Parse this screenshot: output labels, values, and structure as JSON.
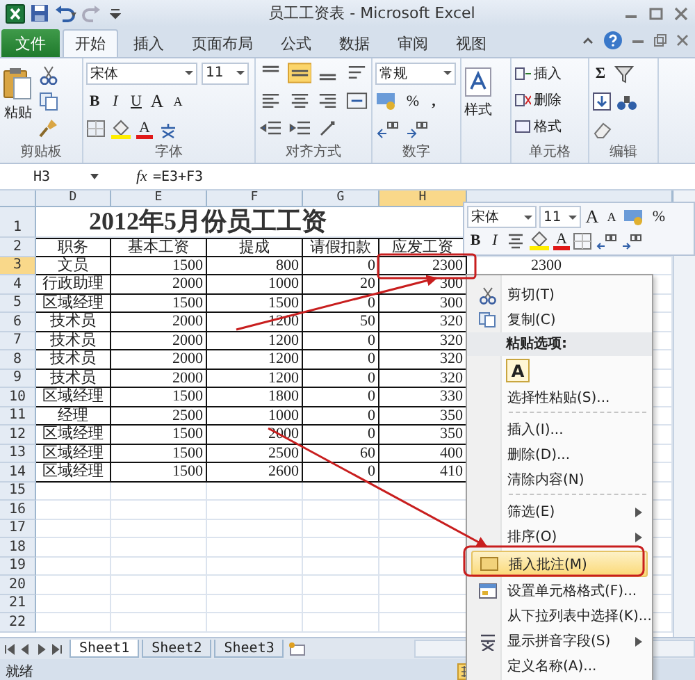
{
  "window": {
    "title": "员工工资表 - Microsoft Excel"
  },
  "tabs": [
    {
      "label": "文件",
      "kind": "file",
      "selected": false
    },
    {
      "label": "开始",
      "kind": "tab",
      "selected": true
    },
    {
      "label": "插入",
      "kind": "tab",
      "selected": false
    },
    {
      "label": "页面布局",
      "kind": "tab",
      "selected": false
    },
    {
      "label": "公式",
      "kind": "tab",
      "selected": false
    },
    {
      "label": "数据",
      "kind": "tab",
      "selected": false
    },
    {
      "label": "审阅",
      "kind": "tab",
      "selected": false
    },
    {
      "label": "视图",
      "kind": "tab",
      "selected": false
    }
  ],
  "ribbon": {
    "clipboard": {
      "paste": "粘贴",
      "label": "剪贴板"
    },
    "font": {
      "name": "宋体",
      "size": "11",
      "bold": "B",
      "italic": "I",
      "underline": "U",
      "grow": "A",
      "shrink": "A",
      "font_color_button": "A",
      "label": "字体"
    },
    "alignment": {
      "label": "对齐方式"
    },
    "number": {
      "format": "常规",
      "percent": "%",
      "comma": ",",
      "label": "数字"
    },
    "styles": {
      "button": "样式"
    },
    "cells": {
      "insert": "插入",
      "delete": "删除",
      "format": "格式",
      "label": "单元格"
    },
    "editing": {
      "sum": "Σ",
      "label": "编辑"
    }
  },
  "formula_bar": {
    "name_box": "H3",
    "function": "fx",
    "formula": "=E3+F3"
  },
  "sheet": {
    "columns": [
      {
        "label": "D",
        "selected": false
      },
      {
        "label": "E",
        "selected": false
      },
      {
        "label": "F",
        "selected": false
      },
      {
        "label": "G",
        "selected": false
      },
      {
        "label": "H",
        "selected": true
      }
    ],
    "row_numbers": [
      {
        "label": "1",
        "selected": false
      },
      {
        "label": "2",
        "selected": false
      },
      {
        "label": "3",
        "selected": true
      },
      {
        "label": "4",
        "selected": false
      },
      {
        "label": "5",
        "selected": false
      },
      {
        "label": "6",
        "selected": false
      },
      {
        "label": "7",
        "selected": false
      },
      {
        "label": "8",
        "selected": false
      },
      {
        "label": "9",
        "selected": false
      },
      {
        "label": "10",
        "selected": false
      },
      {
        "label": "11",
        "selected": false
      },
      {
        "label": "12",
        "selected": false
      },
      {
        "label": "13",
        "selected": false
      },
      {
        "label": "14",
        "selected": false
      },
      {
        "label": "15",
        "selected": false
      },
      {
        "label": "16",
        "selected": false
      },
      {
        "label": "17",
        "selected": false
      },
      {
        "label": "18",
        "selected": false
      },
      {
        "label": "19",
        "selected": false
      },
      {
        "label": "20",
        "selected": false
      },
      {
        "label": "21",
        "selected": false
      },
      {
        "label": "22",
        "selected": false
      }
    ],
    "title": "2012年5月份员工工资",
    "header": [
      "职务",
      "基本工资",
      "提成",
      "请假扣款",
      "应发工资"
    ],
    "rows": [
      [
        "文员",
        "1500",
        "800",
        "0",
        "2300"
      ],
      [
        "行政助理",
        "2000",
        "1000",
        "20",
        "300"
      ],
      [
        "区域经理",
        "1500",
        "1500",
        "0",
        "300"
      ],
      [
        "技术员",
        "2000",
        "1200",
        "50",
        "320"
      ],
      [
        "技术员",
        "2000",
        "1200",
        "0",
        "320"
      ],
      [
        "技术员",
        "2000",
        "1200",
        "0",
        "320"
      ],
      [
        "技术员",
        "2000",
        "1200",
        "0",
        "320"
      ],
      [
        "区域经理",
        "1500",
        "1800",
        "0",
        "330"
      ],
      [
        "经理",
        "2500",
        "1000",
        "0",
        "350"
      ],
      [
        "区域经理",
        "1500",
        "2000",
        "0",
        "350"
      ],
      [
        "区域经理",
        "1500",
        "2500",
        "60",
        "400"
      ],
      [
        "区域经理",
        "1500",
        "2600",
        "0",
        "410"
      ]
    ],
    "stray_value": "2300"
  },
  "sheet_tabs": [
    {
      "label": "Sheet1",
      "selected": true
    },
    {
      "label": "Sheet2",
      "selected": false
    },
    {
      "label": "Sheet3",
      "selected": false
    }
  ],
  "status_bar": {
    "text": "就绪"
  },
  "mini_toolbar": {
    "font": "宋体",
    "size": "11",
    "grow": "A",
    "shrink": "A",
    "percent": "%",
    "bold": "B",
    "italic": "I",
    "font_color_button": "A"
  },
  "context_menu": [
    {
      "label": "剪切(T)",
      "kind": "cut",
      "selected": false,
      "submenu": false
    },
    {
      "label": "复制(C)",
      "kind": "copy",
      "selected": false,
      "submenu": false
    },
    {
      "label": "粘贴选项:",
      "kind": "header"
    },
    {
      "label": "A",
      "kind": "paste",
      "selected": false
    },
    {
      "label": "选择性粘贴(S)...",
      "kind": "plain",
      "selected": false,
      "submenu": false
    },
    {
      "kind": "separator"
    },
    {
      "label": "插入(I)...",
      "kind": "plain",
      "selected": false,
      "submenu": false
    },
    {
      "label": "删除(D)...",
      "kind": "plain",
      "selected": false,
      "submenu": false
    },
    {
      "label": "清除内容(N)",
      "kind": "plain",
      "selected": false,
      "submenu": false
    },
    {
      "kind": "separator"
    },
    {
      "label": "筛选(E)",
      "kind": "plain",
      "selected": false,
      "submenu": true
    },
    {
      "label": "排序(O)",
      "kind": "plain",
      "selected": false,
      "submenu": true
    },
    {
      "label": "插入批注(M)",
      "kind": "comment",
      "selected": true,
      "submenu": false
    },
    {
      "label": "设置单元格格式(F)...",
      "kind": "format",
      "selected": false,
      "submenu": false
    },
    {
      "label": "从下拉列表中选择(K)...",
      "kind": "plain",
      "selected": false,
      "submenu": false
    },
    {
      "label": "显示拼音字段(S)",
      "kind": "phonetic",
      "selected": false,
      "submenu": true
    },
    {
      "label": "定义名称(A)...",
      "kind": "plain",
      "selected": false,
      "submenu": false
    }
  ]
}
